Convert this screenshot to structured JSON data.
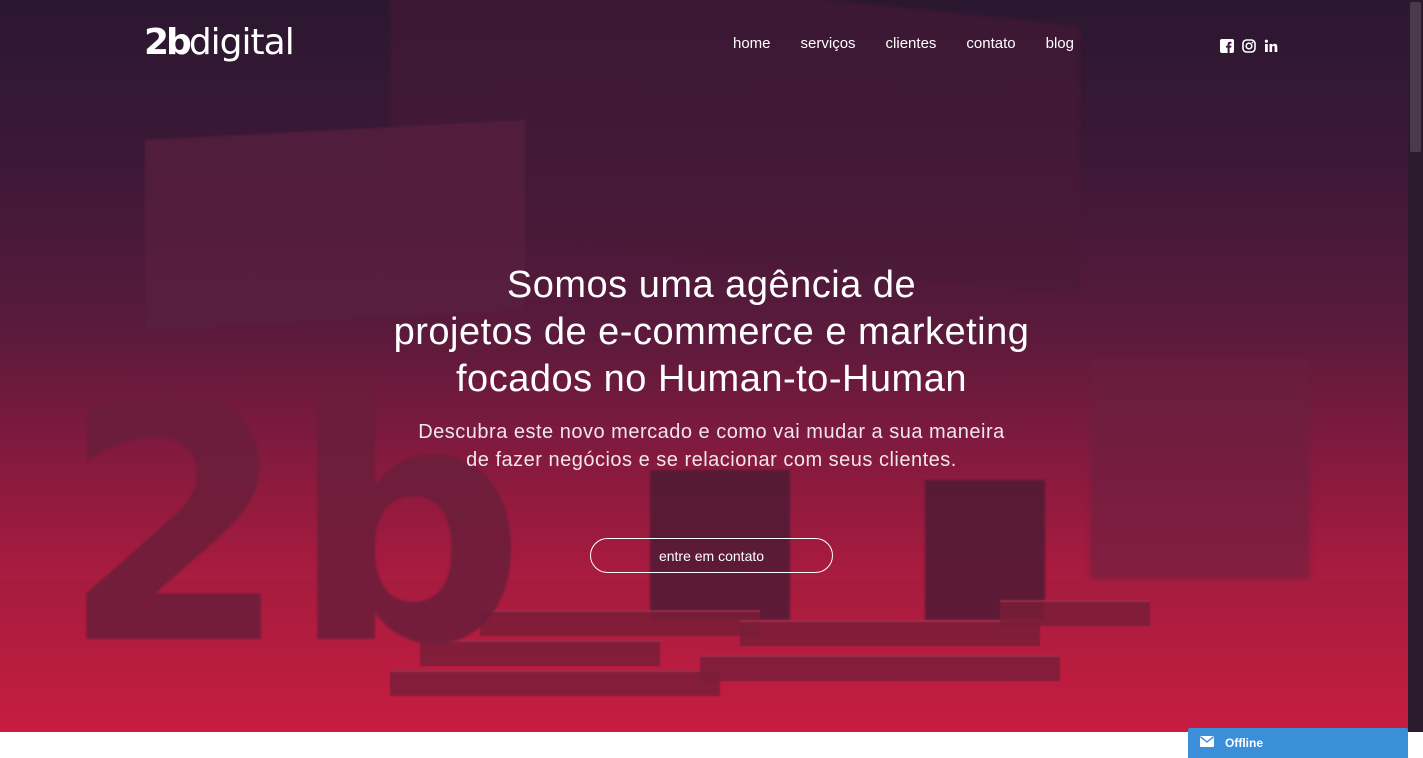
{
  "header": {
    "logo_bold": "2b",
    "logo_text": "digital",
    "nav": [
      "home",
      "serviços",
      "clientes",
      "contato",
      "blog"
    ],
    "social_icons": [
      "facebook-icon",
      "instagram-icon",
      "linkedin-icon"
    ]
  },
  "hero": {
    "headline_lines": [
      "Somos uma agência de",
      "projetos de e-commerce e marketing",
      "focados no Human-to-Human"
    ],
    "sub_lines": [
      "Descubra este novo mercado e como vai mudar a sua maneira",
      "de fazer negócios e se relacionar com seus clientes."
    ],
    "cta_label": "entre em contato"
  },
  "chat": {
    "status": "Offline",
    "icon": "envelope-icon"
  },
  "colors": {
    "overlay_top": "#2b1730",
    "overlay_bottom": "#c81d40",
    "chat": "#3a8fd8"
  }
}
